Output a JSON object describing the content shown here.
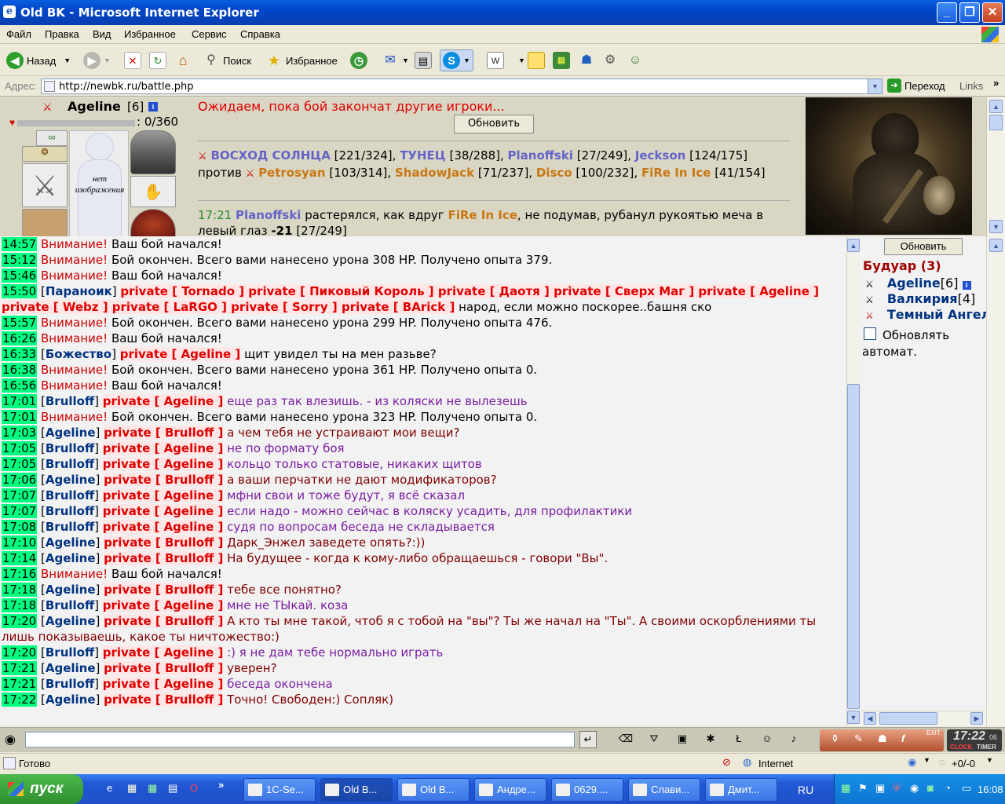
{
  "window": {
    "title": "Old BK - Microsoft Internet Explorer"
  },
  "menu": [
    "Файл",
    "Правка",
    "Вид",
    "Избранное",
    "Сервис",
    "Справка"
  ],
  "toolbar": {
    "back": "Назад",
    "search": "Поиск",
    "favorites": "Избранное"
  },
  "address": {
    "label": "Адрес:",
    "url": "http://newbk.ru/battle.php",
    "go": "Переход",
    "links": "Links"
  },
  "player": {
    "name": "Ageline",
    "level": "[6]",
    "hp": ": 0/360",
    "no_image": "нет изображения"
  },
  "battle": {
    "waiting": "Ожидаем, пока бой закончат другие игроки...",
    "refresh": "Обновить",
    "team1": [
      {
        "name": "ВОСХОД СОЛНЦА",
        "hp": "[221/324],"
      },
      {
        "name": "ТУНЕЦ",
        "hp": "[38/288],"
      },
      {
        "name": "Planoffski",
        "hp": "[27/249],"
      },
      {
        "name": "Jeckson",
        "hp": "[124/175]"
      }
    ],
    "versus": "против",
    "team2": [
      {
        "name": "Petrosyan",
        "hp": "[103/314],"
      },
      {
        "name": "ShadowJack",
        "hp": "[71/237],"
      },
      {
        "name": "Disco",
        "hp": "[100/232],"
      },
      {
        "name": "FiRe In Ice",
        "hp": "[41/154]"
      }
    ],
    "log_time": "17:21",
    "log_actor": "Planoffski",
    "log_mid": "растерялся, как вдруг",
    "log_target": "FiRe In Ice",
    "log_text": ", не подумав, рубанул рукоятью меча в левый глаз",
    "log_dmg": "-21",
    "log_hp": "[27/249]"
  },
  "chat": [
    {
      "t": "14:57",
      "type": "sys",
      "head": "Внимание!",
      "text": "Ваш бой начался!"
    },
    {
      "t": "15:12",
      "type": "sys",
      "head": "Внимание!",
      "text": "Бой окончен. Всего вами нанесено урона 308 HP. Получено опыта 379."
    },
    {
      "t": "15:46",
      "type": "sys",
      "head": "Внимание!",
      "text": "Ваш бой начался!"
    },
    {
      "t": "15:50",
      "type": "mass",
      "from": "Параноик",
      "to": "private [ Tornado ] private [ Пиковый Король ] private [ Даотя ] private [ Сверх Маг ] private [ Ageline ] private [ Webz ] private [ LaRGO ] private [ Sorry ] private [ BArick ]",
      "text": "народ, если можно поскорее..башня ско"
    },
    {
      "t": "15:57",
      "type": "sys",
      "head": "Внимание!",
      "text": "Бой окончен. Всего вами нанесено урона 299 HP. Получено опыта 476."
    },
    {
      "t": "16:26",
      "type": "sys",
      "head": "Внимание!",
      "text": "Ваш бой начался!"
    },
    {
      "t": "16:33",
      "type": "pm",
      "from": "Божество",
      "to": "private [ Ageline ]",
      "text": "щит увидел ты на мен разьве?",
      "color": "black"
    },
    {
      "t": "16:38",
      "type": "sys",
      "head": "Внимание!",
      "text": "Бой окончен. Всего вами нанесено урона 361 HP. Получено опыта 0."
    },
    {
      "t": "16:56",
      "type": "sys",
      "head": "Внимание!",
      "text": "Ваш бой начался!"
    },
    {
      "t": "17:01",
      "type": "pm",
      "from": "Brulloff",
      "to": "private [ Ageline ]",
      "text": "еще раз так влезишь. - из коляски не вылезешь",
      "color": "purple"
    },
    {
      "t": "17:01",
      "type": "sys",
      "head": "Внимание!",
      "text": "Бой окончен. Всего вами нанесено урона 323 HP. Получено опыта 0."
    },
    {
      "t": "17:03",
      "type": "pm",
      "from": "Ageline",
      "to": "private [ Brulloff ]",
      "text": "а чем тебя не устраивают мои вещи?",
      "color": "dark"
    },
    {
      "t": "17:05",
      "type": "pm",
      "from": "Brulloff",
      "to": "private [ Ageline ]",
      "text": "не по формату боя",
      "color": "purple"
    },
    {
      "t": "17:05",
      "type": "pm",
      "from": "Brulloff",
      "to": "private [ Ageline ]",
      "text": "кольцо только статовые, никаких щитов",
      "color": "purple"
    },
    {
      "t": "17:06",
      "type": "pm",
      "from": "Ageline",
      "to": "private [ Brulloff ]",
      "text": "а ваши перчатки не дают модификаторов?",
      "color": "dark"
    },
    {
      "t": "17:07",
      "type": "pm",
      "from": "Brulloff",
      "to": "private [ Ageline ]",
      "text": "мфни свои и тоже будут, я всё сказал",
      "color": "purple"
    },
    {
      "t": "17:07",
      "type": "pm",
      "from": "Brulloff",
      "to": "private [ Ageline ]",
      "text": "если надо - можно сейчас в коляску усадить, для профилактики",
      "color": "purple"
    },
    {
      "t": "17:08",
      "type": "pm",
      "from": "Brulloff",
      "to": "private [ Ageline ]",
      "text": "судя по вопросам беседа не складывается",
      "color": "purple"
    },
    {
      "t": "17:10",
      "type": "pm",
      "from": "Ageline",
      "to": "private [ Brulloff ]",
      "text": "Дарк_Энжел заведете опять?:))",
      "color": "dark"
    },
    {
      "t": "17:14",
      "type": "pm",
      "from": "Ageline",
      "to": "private [ Brulloff ]",
      "text": "На будущее - когда к кому-либо обращаешься - говори \"Вы\".",
      "color": "dark"
    },
    {
      "t": "17:16",
      "type": "sys",
      "head": "Внимание!",
      "text": "Ваш бой начался!"
    },
    {
      "t": "17:18",
      "type": "pm",
      "from": "Ageline",
      "to": "private [ Brulloff ]",
      "text": "тебе все понятно?",
      "color": "dark"
    },
    {
      "t": "17:18",
      "type": "pm",
      "from": "Brulloff",
      "to": "private [ Ageline ]",
      "text": "мне не ТЫкай. коза",
      "color": "purple"
    },
    {
      "t": "17:20",
      "type": "pm",
      "from": "Ageline",
      "to": "private [ Brulloff ]",
      "text": "А кто ты мне такой, чтоб я с тобой на \"вы\"? Ты же начал на \"Ты\". А своими оскорблениями ты лишь показываешь, какое ты ничтожество:)",
      "color": "dark"
    },
    {
      "t": "17:20",
      "type": "pm",
      "from": "Brulloff",
      "to": "private [ Ageline ]",
      "text": ":) я не дам тебе нормально играть",
      "color": "purple"
    },
    {
      "t": "17:21",
      "type": "pm",
      "from": "Ageline",
      "to": "private [ Brulloff ]",
      "text": "уверен?",
      "color": "dark"
    },
    {
      "t": "17:21",
      "type": "pm",
      "from": "Brulloff",
      "to": "private [ Ageline ]",
      "text": "беседа окончена",
      "color": "purple"
    },
    {
      "t": "17:22",
      "type": "pm",
      "from": "Ageline",
      "to": "private [ Brulloff ]",
      "text": "Точно! Свободен:) Сопляк)",
      "color": "dark"
    }
  ],
  "side": {
    "refresh": "Обновить",
    "room": "Будуар (3)",
    "users": [
      {
        "name": "Ageline",
        "level": "[6]"
      },
      {
        "name": "Валкирия",
        "level": "[4]"
      },
      {
        "name": "Темный Ангел",
        "level": ""
      }
    ],
    "auto_label": "Обновлять автомат."
  },
  "bottom": {
    "clock": "17:22",
    "clock_sec": "06",
    "clock_label": "CLOCK",
    "timer_label": "TIMER",
    "exit": "EXIT"
  },
  "status": {
    "ready": "Готово",
    "zone": "Internet",
    "counter": "+0/-0"
  },
  "taskbar": {
    "start": "пуск",
    "buttons": [
      "1C-Se...",
      "Old B...",
      "Old B...",
      "Андре...",
      "0629....",
      "Слави...",
      "Дмит..."
    ],
    "lang": "RU",
    "time": "16:08"
  }
}
